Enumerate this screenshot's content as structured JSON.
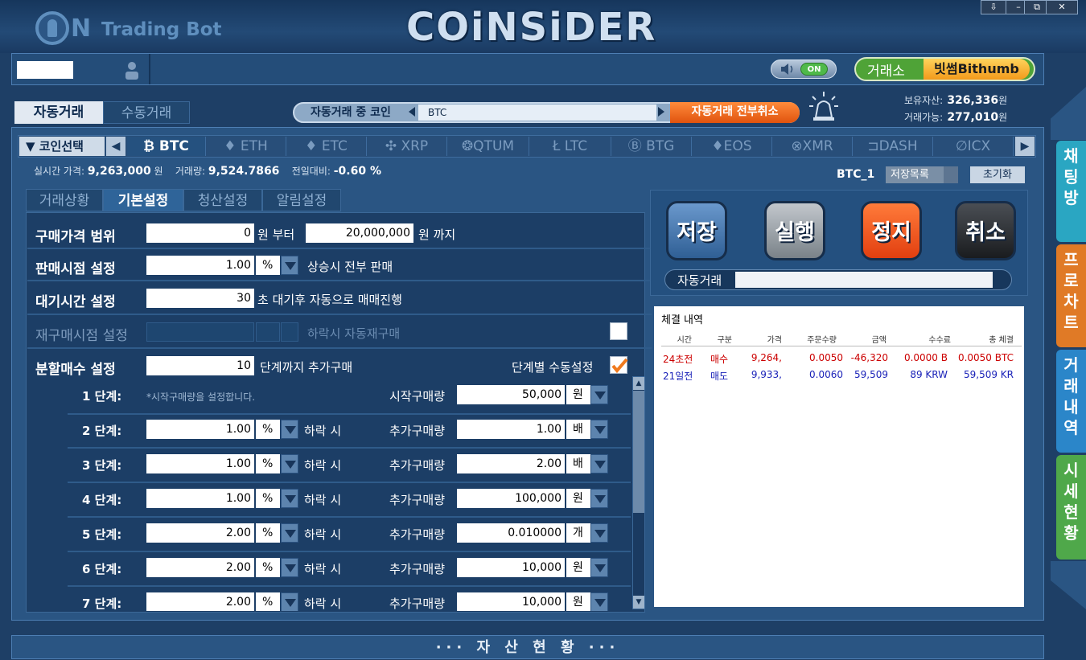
{
  "app": {
    "logo_trading": "Trading Bot",
    "brand": "COiNSiDER"
  },
  "window_controls": [
    "⇩",
    "–",
    "⧉",
    "✕"
  ],
  "header": {
    "sound_toggle": "ON",
    "exchange_label": "거래소",
    "exchange_value": "빗썸Bithumb"
  },
  "mode_tabs": {
    "auto": "자동거래",
    "manual": "수동거래"
  },
  "current_coin": {
    "label": "자동거래 중 코인",
    "value": "BTC",
    "cancel_all": "자동거래 전부취소"
  },
  "assets": {
    "held_label": "보유자산:",
    "held_value": "326,336",
    "avail_label": "거래가능:",
    "avail_value": "277,010",
    "unit": "원"
  },
  "coin_select_label": "▼ 코인선택",
  "coins": [
    "₿ BTC",
    "♦ ETH",
    "♦ ETC",
    "✣ XRP",
    "❂QTUM",
    "Ł LTC",
    "Ⓑ BTG",
    "♦EOS",
    "⊗XMR",
    "⊐DASH",
    "∅ICX"
  ],
  "price_line": {
    "price_label": "실시간 가격:",
    "price": "9,263,000",
    "price_unit": "원",
    "volume_label": "거래량:",
    "volume": "9,524.7866",
    "change_label": "전일대비:",
    "change": "-0.60 %"
  },
  "preset": {
    "name": "BTC_1",
    "list_label": "저장목록",
    "reset": "초기화"
  },
  "sub_tabs": [
    "거래상황",
    "기본설정",
    "청산설정",
    "알림설정"
  ],
  "settings": {
    "buy_range": {
      "label": "구매가격 범위",
      "from": "0",
      "from_suffix": "원 부터",
      "to": "20,000,000",
      "to_suffix": "원 까지"
    },
    "sell_point": {
      "label": "판매시점 설정",
      "value": "1.00",
      "unit": "%",
      "suffix": "상승시 전부 판매"
    },
    "wait_time": {
      "label": "대기시간 설정",
      "value": "30",
      "suffix": "초 대기후 자동으로 매매진행"
    },
    "rebuy": {
      "label": "재구매시점 설정",
      "suffix": "하락시 자동재구매"
    },
    "split": {
      "label": "분할매수 설정",
      "value": "10",
      "suffix": "단계까지 추가구매",
      "manual_label": "단계별 수동설정"
    }
  },
  "steps": [
    {
      "step": "1 단계:",
      "pct": "",
      "pct_unit": "",
      "note": "*시작구매량을 설정합니다.",
      "amount_label": "시작구매량",
      "amount": "50,000",
      "amount_unit": "원"
    },
    {
      "step": "2 단계:",
      "pct": "1.00",
      "pct_unit": "%",
      "note": "하락 시",
      "amount_label": "추가구매량",
      "amount": "1.00",
      "amount_unit": "배"
    },
    {
      "step": "3 단계:",
      "pct": "1.00",
      "pct_unit": "%",
      "note": "하락 시",
      "amount_label": "추가구매량",
      "amount": "2.00",
      "amount_unit": "배"
    },
    {
      "step": "4 단계:",
      "pct": "1.00",
      "pct_unit": "%",
      "note": "하락 시",
      "amount_label": "추가구매량",
      "amount": "100,000",
      "amount_unit": "원"
    },
    {
      "step": "5 단계:",
      "pct": "2.00",
      "pct_unit": "%",
      "note": "하락 시",
      "amount_label": "추가구매량",
      "amount": "0.010000",
      "amount_unit": "개"
    },
    {
      "step": "6 단계:",
      "pct": "2.00",
      "pct_unit": "%",
      "note": "하락 시",
      "amount_label": "추가구매량",
      "amount": "10,000",
      "amount_unit": "원"
    },
    {
      "step": "7 단계:",
      "pct": "2.00",
      "pct_unit": "%",
      "note": "하락 시",
      "amount_label": "추가구매량",
      "amount": "10,000",
      "amount_unit": "원"
    }
  ],
  "controls": {
    "save": "저장",
    "run": "실행",
    "stop": "정지",
    "cancel": "취소",
    "status_label": "자동거래"
  },
  "history": {
    "title": "체결 내역",
    "headers": [
      "시간",
      "구분",
      "가격",
      "주문수량",
      "금액",
      "수수료",
      "총 체결"
    ],
    "rows": [
      {
        "color": "#cc0000",
        "cells": [
          "24초전",
          "매수",
          "9,264,",
          "0.0050",
          "-46,320",
          "0.0000 B",
          "0.0050 BTC"
        ]
      },
      {
        "color": "#1a22b8",
        "cells": [
          "21일전",
          "매도",
          "9,933,",
          "0.0060",
          "59,509",
          "89 KRW",
          "59,509 KR"
        ]
      }
    ]
  },
  "side_tabs": [
    {
      "label": "채팅방",
      "color": "#2aa6c2"
    },
    {
      "label": "프로차트",
      "color": "#e07a26"
    },
    {
      "label": "거래내역",
      "color": "#2b86c9"
    },
    {
      "label": "시세현황",
      "color": "#4fa84a"
    }
  ],
  "bottom": {
    "label": "··· 자 산 현 황 ···"
  }
}
